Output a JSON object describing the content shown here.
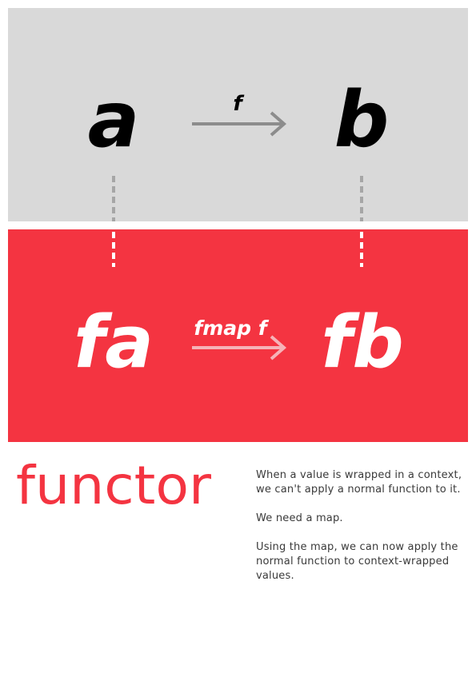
{
  "top_panel": {
    "source_value": "a",
    "target_value": "b",
    "arrow_label": "f"
  },
  "bottom_panel": {
    "source_value": "fa",
    "target_value": "fb",
    "arrow_label": "fmap f"
  },
  "title": "functor",
  "description": [
    "When a value is wrapped in a context, we can't apply a normal function to it.",
    "We need a map.",
    "Using the map, we can now apply the normal function to context-wrapped values."
  ],
  "colors": {
    "top_background": "#d9d9d9",
    "bottom_background": "#f43441",
    "title": "#f43441",
    "arrow_top": "#8c8c8c",
    "arrow_bottom": "#f6b3b8",
    "connector": "#a6a6a6",
    "text": "#3a3a3a"
  }
}
